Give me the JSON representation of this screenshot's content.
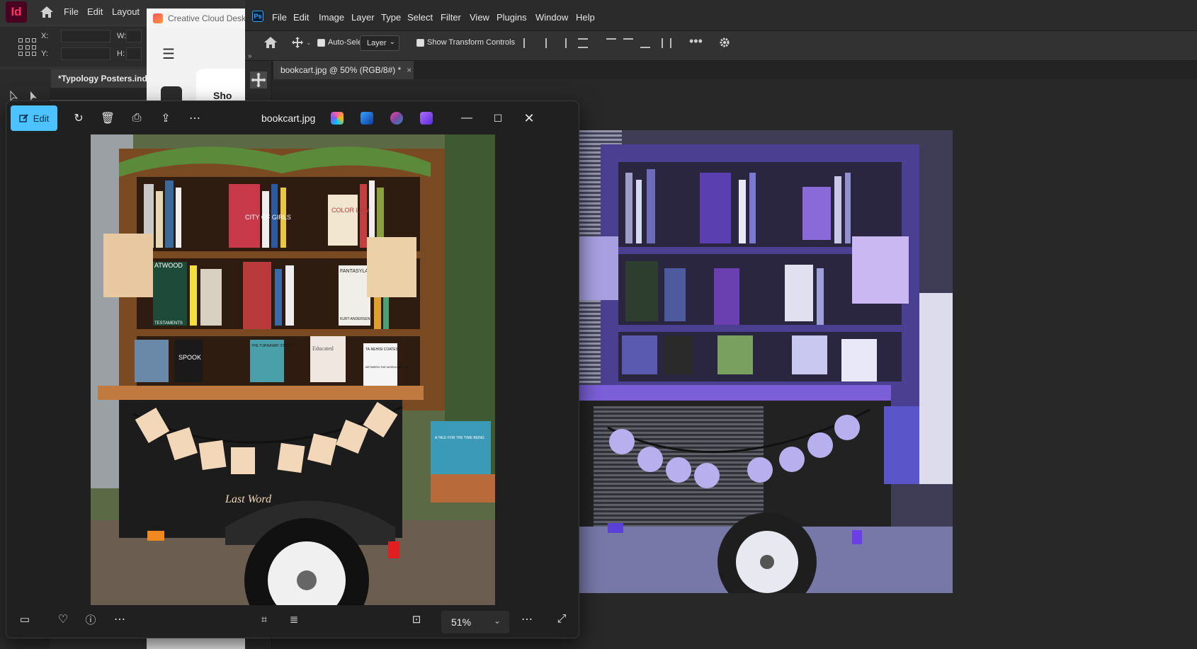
{
  "indesign": {
    "app_icon": "Id",
    "menu": [
      "File",
      "Edit",
      "Layout"
    ],
    "field_x_label": "X:",
    "field_y_label": "Y:",
    "field_w_label": "W:",
    "field_h_label": "H:",
    "doc_tab": "*Typology Posters.indd"
  },
  "creative_cloud": {
    "title": "Creative Cloud Desktop",
    "card_text": "Sho"
  },
  "photoshop": {
    "app_icon": "Ps",
    "menu": [
      "File",
      "Edit",
      "Image",
      "Layer",
      "Type",
      "Select",
      "Filter",
      "View",
      "Plugins",
      "Window",
      "Help"
    ],
    "options": {
      "auto_select_label": "Auto-Select:",
      "layer_select_value": "Layer",
      "show_transform_label": "Show Transform Controls"
    },
    "doc_tab": "bookcart.jpg @ 50% (RGB/8#) *",
    "colors": {
      "accent": "#31a8ff"
    }
  },
  "photos": {
    "edit_label": "Edit",
    "file_name": "bookcart.jpg",
    "zoom": "51%",
    "colors": {
      "accent": "#4cc2ff"
    }
  },
  "artwork": {
    "banner_text": "Last Word",
    "book_titles": [
      "CITY OF GIRLS",
      "COLOR LAW",
      "ATWOOD",
      "TESTAMENTS",
      "FANTASYLAND",
      "KURT ANDERSEN",
      "SPOOK",
      "THE TURNAWAY STUDY",
      "Educated",
      "TA-NEHISI COATES",
      "BETWEEN THE WORLD AND ME",
      "A TALE FOR THE TIME BEING"
    ]
  }
}
